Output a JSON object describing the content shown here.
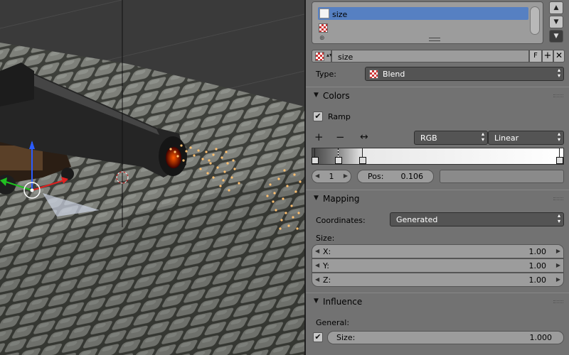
{
  "viewport": {
    "description_icons": [
      "cursor-3d-icon",
      "gizmo-x-arrow-icon",
      "gizmo-y-arrow-icon",
      "gizmo-z-arrow-icon",
      "light-icon"
    ]
  },
  "slots": {
    "items": [
      {
        "label": "size"
      }
    ],
    "icons": [
      "texture-thumbnail-icon",
      "checker-texture-icon",
      "add-slot-icon"
    ]
  },
  "texture": {
    "name": "size",
    "fake_user_label": "F",
    "new_label": "+",
    "unlink_label": "✕"
  },
  "type": {
    "label": "Type:",
    "value": "Blend"
  },
  "colors": {
    "title": "Colors",
    "ramp_label": "Ramp",
    "ramp_checked": true,
    "mode": "RGB",
    "interpolation": "Linear",
    "stop_index": "1",
    "pos_label": "Pos:",
    "pos_value": "0.106",
    "stops": [
      0.0,
      0.106,
      0.2,
      1.0
    ],
    "active_stop": 1
  },
  "mapping": {
    "title": "Mapping",
    "coordinates_label": "Coordinates:",
    "coordinates_value": "Generated",
    "size_label": "Size:",
    "size_x_label": "X:",
    "size_x_value": "1.00",
    "size_y_label": "Y:",
    "size_y_value": "1.00",
    "size_z_label": "Z:",
    "size_z_value": "1.00"
  },
  "influence": {
    "title": "Influence",
    "general_label": "General:",
    "size_label": "Size:",
    "size_value": "1.000",
    "size_checked": true
  },
  "colors_theme": {
    "selection": "#5680c2",
    "panel_bg": "#727272",
    "dropdown_bg": "#545454",
    "particle": "#ffc070"
  }
}
